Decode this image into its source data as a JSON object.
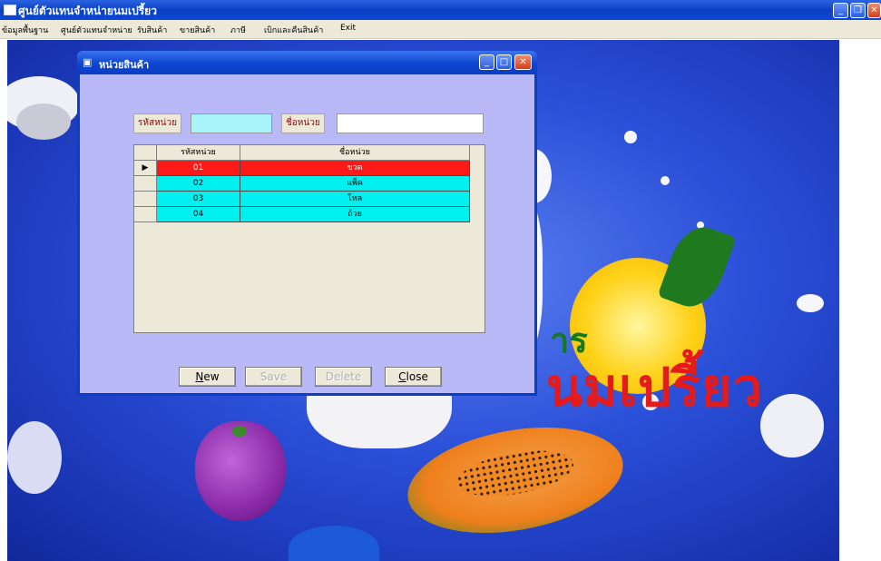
{
  "window": {
    "title": "ศูนย์ตัวแทนจำหน่ายนมเปรี้ยว"
  },
  "menu": [
    "ข้อมูลพื้นฐาน",
    "ศูนย์ตัวแทนจำหน่าย",
    "รับสินค้า",
    "ขายสินค้า",
    "ภาษี",
    "เบิกและคืนสินค้า",
    "Exit"
  ],
  "background": {
    "line1": "าร",
    "line2": "นมเปรี้ยว"
  },
  "dialog": {
    "title": "หน่วยสินค้า",
    "code_label": "รหัสหน่วย",
    "code_value": "",
    "name_label": "ชื่อหน่วย",
    "name_value": "",
    "grid": {
      "columns": [
        "รหัสหน่วย",
        "ชื่อหน่วย"
      ],
      "current_row_marker": "▶",
      "rows": [
        {
          "code": "01",
          "name": "ขวด"
        },
        {
          "code": "02",
          "name": "แพ็ค"
        },
        {
          "code": "03",
          "name": "โหล"
        },
        {
          "code": "04",
          "name": "ถ้วย"
        }
      ]
    },
    "buttons": {
      "new": {
        "mnemonic": "N",
        "rest": "ew"
      },
      "save": "Save",
      "delete": "Delete",
      "close": {
        "mnemonic": "C",
        "rest": "lose"
      }
    }
  },
  "colors": {
    "selected_row": "#ff1a1a",
    "row": "#00f0f0",
    "code_input": "#a8f4fb",
    "dialog_body": "#b9b9f7",
    "titlebar": "#0a3fc4"
  }
}
